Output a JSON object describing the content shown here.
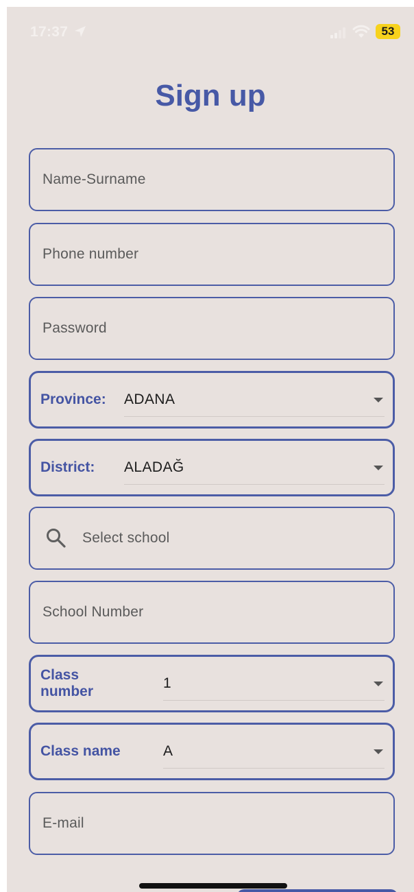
{
  "status_bar": {
    "time": "17:37",
    "battery_level": "53"
  },
  "page": {
    "title": "Sign up"
  },
  "form": {
    "name_placeholder": "Name-Surname",
    "phone_placeholder": "Phone number",
    "password_placeholder": "Password",
    "province": {
      "label": "Province:",
      "value": "ADANA"
    },
    "district": {
      "label": "District:",
      "value": "ALADAĞ"
    },
    "school_search_placeholder": "Select school",
    "school_number_placeholder": "School Number",
    "class_number": {
      "label": "Class number",
      "value": "1"
    },
    "class_name": {
      "label": "Class name",
      "value": "A"
    },
    "email_placeholder": "E-mail"
  },
  "colors": {
    "accent": "#4759a6",
    "background": "#e8e1de",
    "battery": "#f7d21c"
  },
  "icons": {
    "location": "location-arrow-icon",
    "signal": "cellular-signal-icon",
    "wifi": "wifi-icon",
    "search": "search-icon",
    "dropdown": "caret-down-icon"
  }
}
